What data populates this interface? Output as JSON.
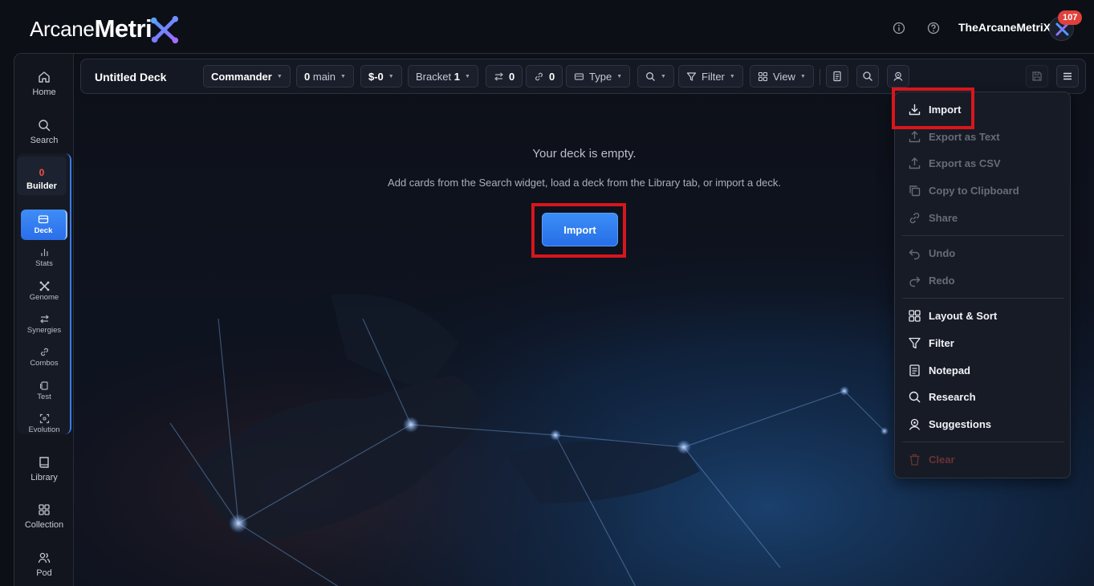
{
  "header": {
    "logo_part1": "Arcane",
    "logo_part2": "Metri",
    "username": "TheArcaneMetriX",
    "notification_count": "107",
    "icons": [
      "info-icon",
      "help-icon"
    ]
  },
  "sidebar": {
    "home": "Home",
    "search": "Search",
    "builder_count": "0",
    "builder": "Builder",
    "sub": {
      "deck": "Deck",
      "stats": "Stats",
      "genome": "Genome",
      "synergies": "Synergies",
      "combos": "Combos",
      "test": "Test",
      "evolution": "Evolution"
    },
    "library": "Library",
    "collection": "Collection",
    "pod": "Pod"
  },
  "toolbar": {
    "deck_name": "Untitled Deck",
    "format": "Commander",
    "main_count": "0",
    "main_label": "main",
    "price": "$-0",
    "bracket_label": "Bracket",
    "bracket_value": "1",
    "swap_count": "0",
    "link_count": "0",
    "type_label": "Type",
    "filter_label": "Filter",
    "view_label": "View"
  },
  "empty_state": {
    "title": "Your deck is empty.",
    "subtitle": "Add cards from the Search widget, load a deck from the Library tab, or import a deck.",
    "import_button": "Import"
  },
  "menu": {
    "import": "Import",
    "export_text": "Export as Text",
    "export_csv": "Export as CSV",
    "copy_clipboard": "Copy to Clipboard",
    "share": "Share",
    "undo": "Undo",
    "redo": "Redo",
    "layout_sort": "Layout & Sort",
    "filter": "Filter",
    "notepad": "Notepad",
    "research": "Research",
    "suggestions": "Suggestions",
    "clear": "Clear"
  },
  "colors": {
    "accent": "#3b8df7",
    "highlight": "#d8161d",
    "badge": "#e0413b",
    "background": "#0c0f16"
  }
}
